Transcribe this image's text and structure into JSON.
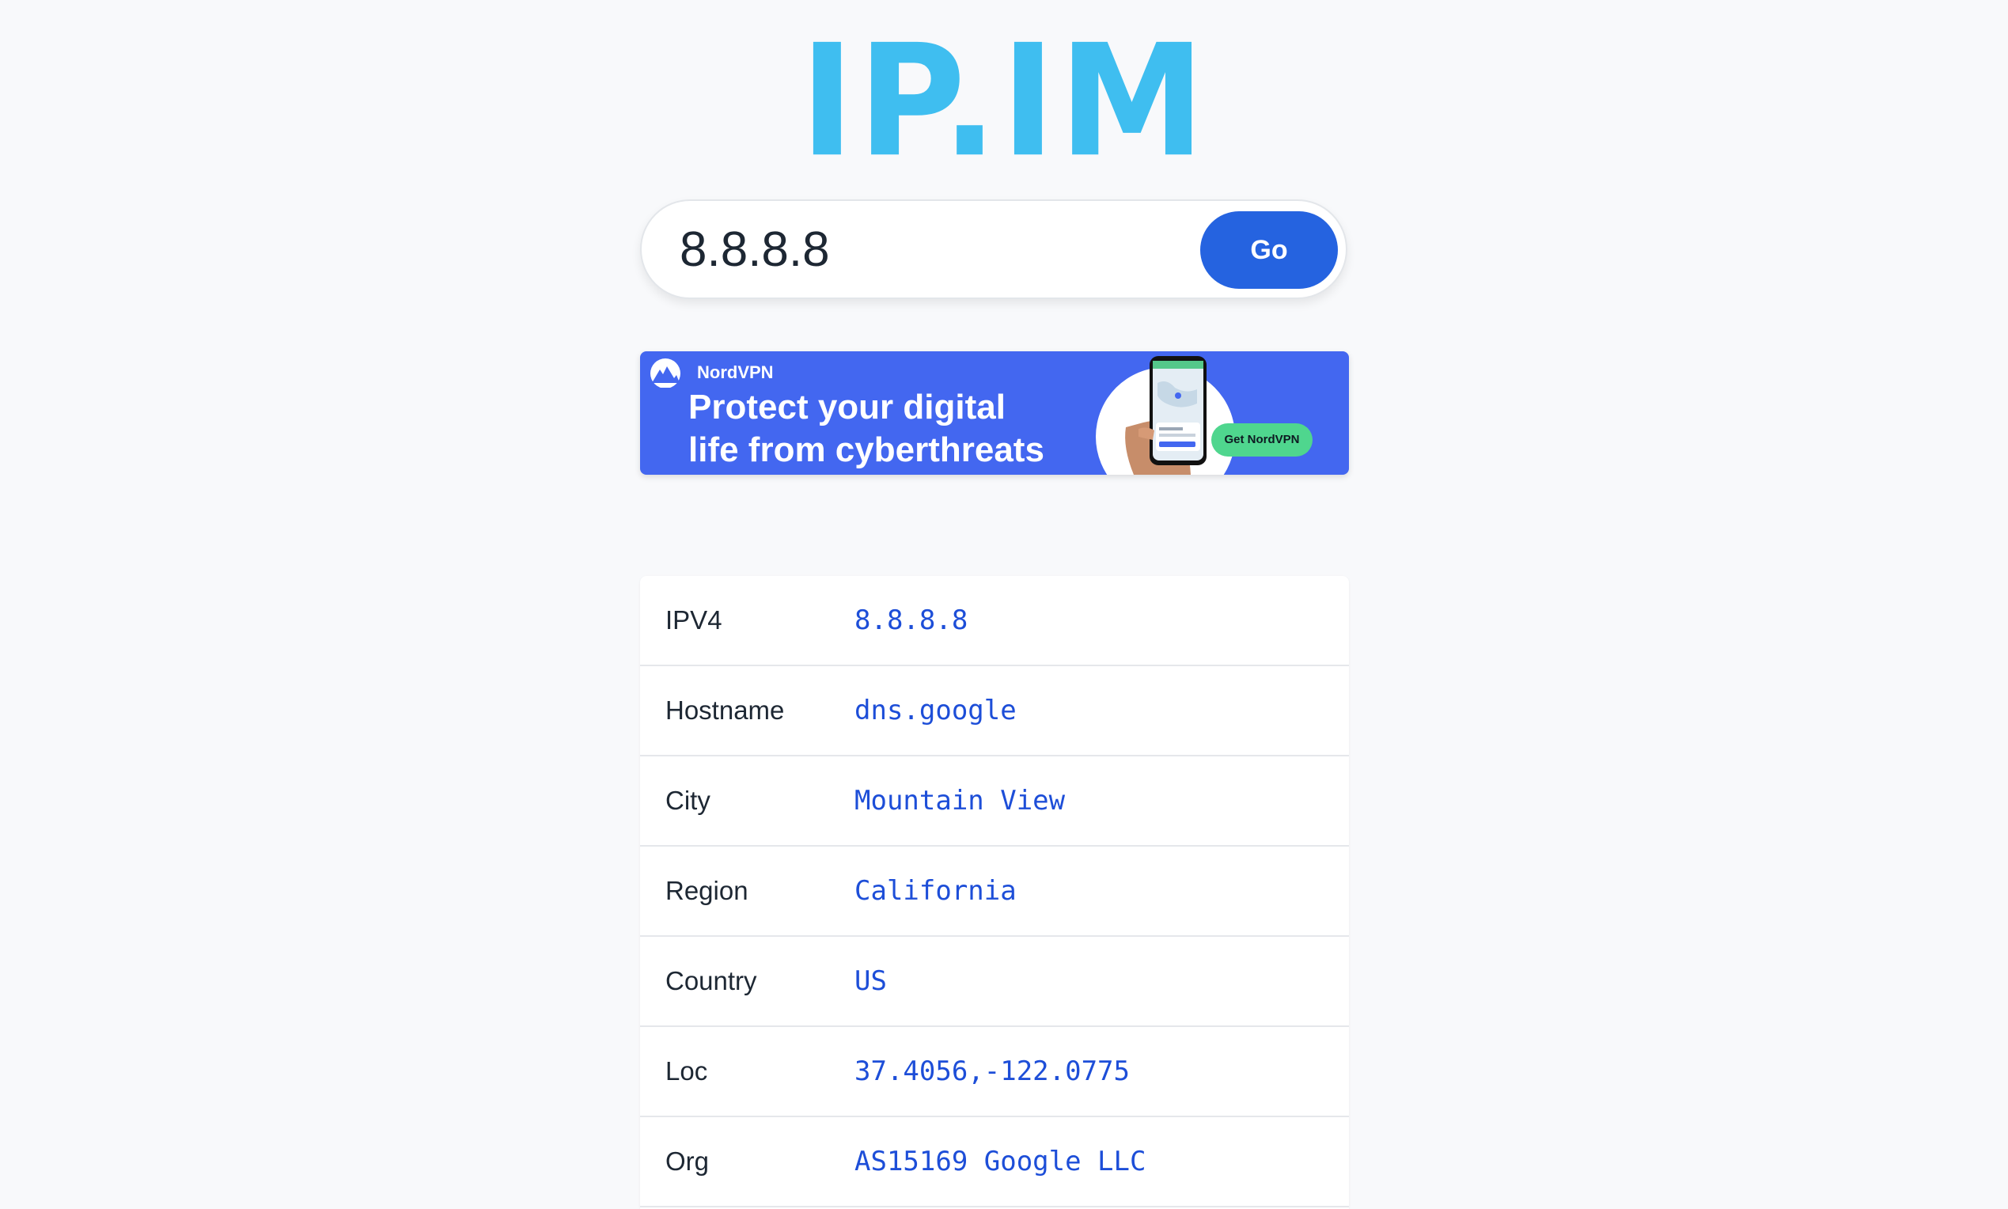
{
  "logo": {
    "text": "IP.IM"
  },
  "search": {
    "value": "8.8.8.8",
    "button_label": "Go"
  },
  "ad": {
    "brand": "NordVPN",
    "headline_line1": "Protect your digital",
    "headline_line2": "life from cyberthreats",
    "cta_label": "Get NordVPN",
    "colors": {
      "background": "#4367f0",
      "cta": "#4fd68e"
    }
  },
  "info": {
    "rows": [
      {
        "label": "IPV4",
        "value": "8.8.8.8"
      },
      {
        "label": "Hostname",
        "value": "dns.google"
      },
      {
        "label": "City",
        "value": "Mountain View"
      },
      {
        "label": "Region",
        "value": "California"
      },
      {
        "label": "Country",
        "value": "US"
      },
      {
        "label": "Loc",
        "value": "37.4056,-122.0775"
      },
      {
        "label": "Org",
        "value": "AS15169 Google LLC"
      }
    ]
  },
  "colors": {
    "logo": "#3fbef0",
    "button": "#2563e0",
    "value_text": "#1d4ed8",
    "page_background": "#f8f9fb"
  }
}
